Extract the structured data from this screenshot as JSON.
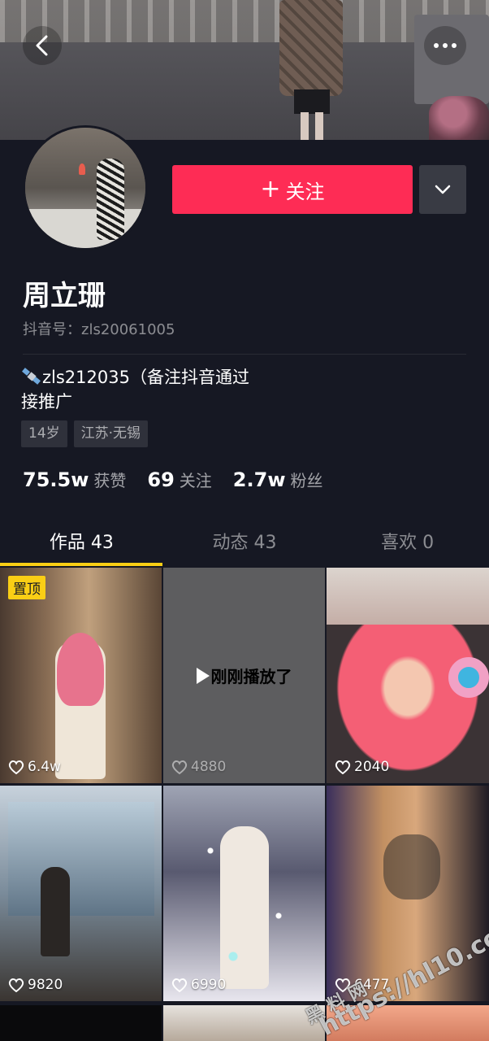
{
  "header": {
    "back_icon": "chevron-left-icon",
    "more_icon": "more-dots-icon"
  },
  "profile": {
    "name": "周立珊",
    "douyin_id": "抖音号：zls20061005",
    "follow_label": "关注",
    "follow_icon": "plus-icon",
    "dropdown_icon": "chevron-down-icon",
    "bio_line1": "zls212035（备注抖音通过",
    "bio_line2": "接推广",
    "tags": [
      "14岁",
      "江苏·无锡"
    ],
    "stats": [
      {
        "num": "75.5w",
        "label": "获赞"
      },
      {
        "num": "69",
        "label": "关注"
      },
      {
        "num": "2.7w",
        "label": "粉丝"
      }
    ]
  },
  "tabs": [
    {
      "label": "作品 43",
      "active": true
    },
    {
      "label": "动态 43",
      "active": false
    },
    {
      "label": "喜欢 0",
      "active": false
    }
  ],
  "videos": [
    {
      "likes": "6.4w",
      "pinned": "置顶"
    },
    {
      "likes": "4880",
      "overlay": "刚刚播放了"
    },
    {
      "likes": "2040"
    },
    {
      "likes": "9820"
    },
    {
      "likes": "6990"
    },
    {
      "likes": "6477"
    }
  ],
  "watermark": {
    "text1": "黑 料 网",
    "text2": "https://hl10.co"
  },
  "colors": {
    "background": "#161823",
    "follow_button": "#fe2c55",
    "tab_indicator": "#face15"
  }
}
